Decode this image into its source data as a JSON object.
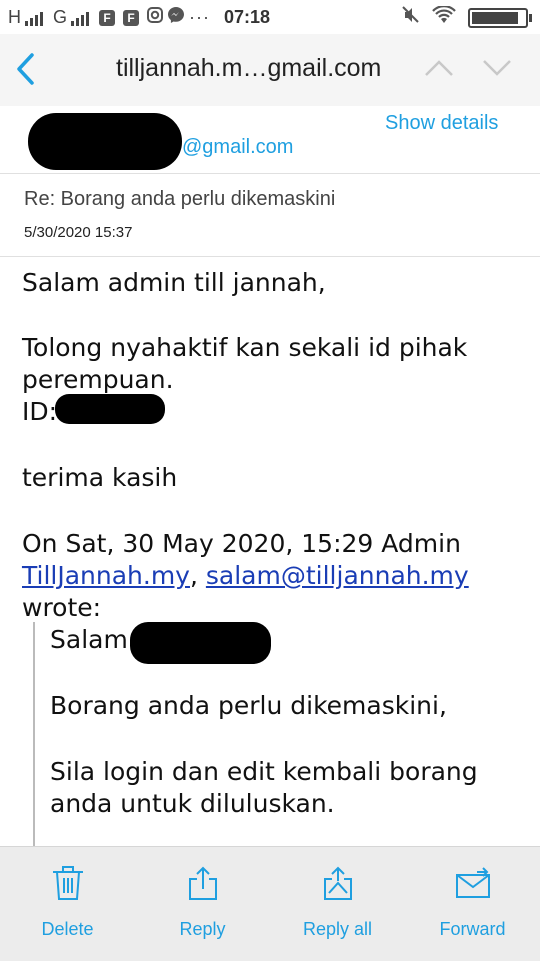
{
  "status_bar": {
    "network1": "H",
    "network2": "G",
    "app_icon_1": "F",
    "app_icon_2": "F",
    "time": "07:18",
    "battery_level": 0.9
  },
  "email_header": {
    "title": "tilljannah.m…gmail.com",
    "sender_domain": "@gmail.com",
    "show_details": "Show details",
    "subject": "Re: Borang anda perlu dikemaskini",
    "date": "5/30/2020 15:37"
  },
  "email_body": {
    "greeting": "Salam admin till jannah,",
    "line1": "Tolong nyahaktif kan sekali id pihak",
    "line2": "perempuan.",
    "id_label": "ID:",
    "thanks": "terima kasih",
    "quote_intro": "On Sat, 30 May 2020, 15:29 Admin",
    "quote_link1": "TillJannah.my",
    "quote_sep": ", ",
    "quote_link2": "salam@tilljannah.my",
    "quote_wrote": "wrote:",
    "quoted_salam": "Salam",
    "quoted_line1": "Borang anda perlu dikemaskini,",
    "quoted_line2": "Sila login dan edit kembali borang",
    "quoted_line3": "anda untuk diluluskan."
  },
  "toolbar": {
    "delete": "Delete",
    "reply": "Reply",
    "reply_all": "Reply all",
    "forward": "Forward"
  },
  "colors": {
    "accent": "#1f9fe0",
    "link": "#1a3db5",
    "toolbar_bg": "#ececec"
  }
}
